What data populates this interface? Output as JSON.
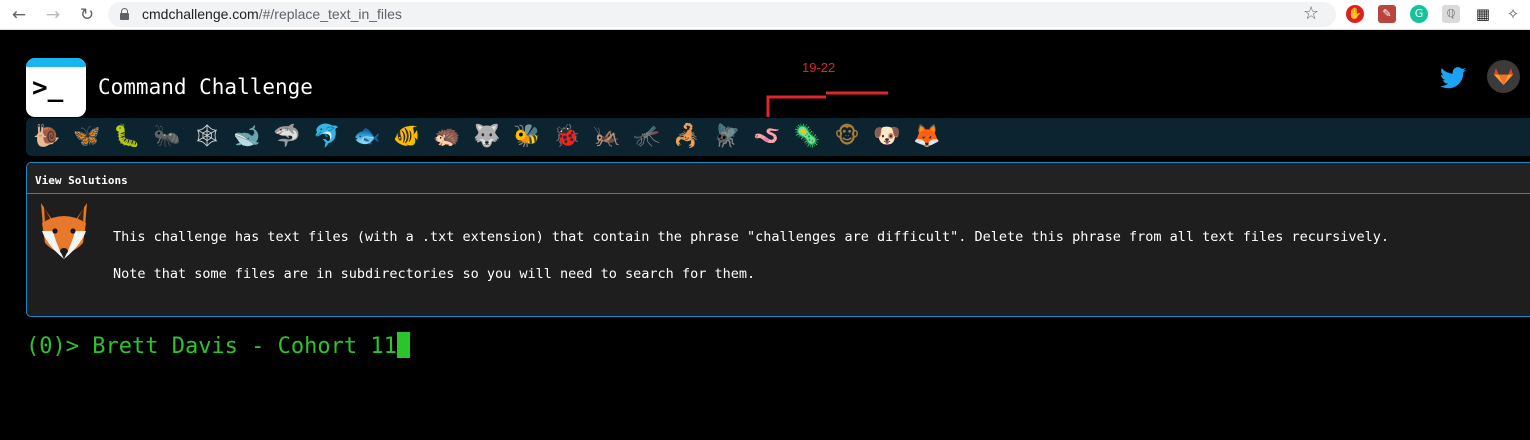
{
  "browser": {
    "url_host": "cmdchallenge.com",
    "url_path": "/#/replace_text_in_files",
    "back_icon": "arrow-left",
    "forward_icon": "arrow-right",
    "reload_icon": "reload",
    "lock_icon": "lock",
    "bookmark_icon": "star-outline",
    "extensions": [
      "adblock-icon",
      "pdf-icon",
      "grammarly-icon",
      "reader-icon",
      "grid-icon",
      "puzzle-extensions-icon"
    ]
  },
  "header": {
    "title": "Command Challenge",
    "logo_glyph": ">_",
    "twitter_icon": "twitter-bird",
    "gitlab_icon": "gitlab-fox"
  },
  "annotation": {
    "label": "19-22",
    "color": "#e0262b"
  },
  "badges": [
    {
      "name": "snail-icon",
      "glyph": "🐌",
      "color": "#8a6a3a"
    },
    {
      "name": "butterfly-icon",
      "glyph": "🦋",
      "color": "#e08a1e"
    },
    {
      "name": "caterpillar-icon",
      "glyph": "🐛",
      "color": "#6cb33a"
    },
    {
      "name": "ant-icon",
      "glyph": "🐜",
      "color": "#3a2a1a"
    },
    {
      "name": "spiderweb-icon",
      "glyph": "🕸",
      "color": "#cfcfcf"
    },
    {
      "name": "whale-icon",
      "glyph": "🐋",
      "color": "#3d8fcf"
    },
    {
      "name": "shark-icon",
      "glyph": "🦈",
      "color": "#5fa9d8"
    },
    {
      "name": "dolphin-icon",
      "glyph": "🐬",
      "color": "#9fb8c8"
    },
    {
      "name": "fish-icon",
      "glyph": "🐟",
      "color": "#5fb8e8"
    },
    {
      "name": "tropical-fish-icon",
      "glyph": "🐠",
      "color": "#f1c12a"
    },
    {
      "name": "hedgehog-icon",
      "glyph": "🦔",
      "color": "#8a6a3a"
    },
    {
      "name": "wolf-icon",
      "glyph": "🐺",
      "color": "#9a9a9a"
    },
    {
      "name": "bee-icon",
      "glyph": "🐝",
      "color": "#f2c318"
    },
    {
      "name": "ladybug-icon",
      "glyph": "🐞",
      "color": "#d8302a"
    },
    {
      "name": "cricket-icon",
      "glyph": "🦗",
      "color": "#6cb33a"
    },
    {
      "name": "mosquito-icon",
      "glyph": "🦟",
      "color": "#6a6a6a"
    },
    {
      "name": "scorpion-icon",
      "glyph": "🦂",
      "color": "#d8302a"
    },
    {
      "name": "fly-icon",
      "glyph": "🪰",
      "color": "#cfcfcf"
    },
    {
      "name": "worm-icon",
      "glyph": "🪱",
      "color": "#e07a9a"
    },
    {
      "name": "microbe-icon",
      "glyph": "🦠",
      "color": "#6fa8dc"
    },
    {
      "name": "monkey-icon",
      "glyph": "🐵",
      "color": "#a67c3a"
    },
    {
      "name": "dog-icon",
      "glyph": "🐶",
      "color": "#c98a2e"
    },
    {
      "name": "fox-icon",
      "glyph": "🦊",
      "color": "#f07a2a"
    }
  ],
  "solutions": {
    "title": "View Solutions",
    "fox_icon": "fox-face",
    "description": "This challenge has text files (with a .txt extension) that contain the phrase \"challenges are difficult\". Delete this phrase from all text files recursively.",
    "note": "Note that some files are in subdirectories so you will need to search for them."
  },
  "terminal": {
    "prompt": "(0)> ",
    "input": "Brett Davis - Cohort 11"
  },
  "colors": {
    "background": "#000000",
    "panel": "#1e1e1e",
    "panel_border": "#1a8ac4",
    "badges_bar": "#0b2430",
    "terminal_green": "#2bc52b",
    "logo_accent": "#1ab4f0"
  }
}
